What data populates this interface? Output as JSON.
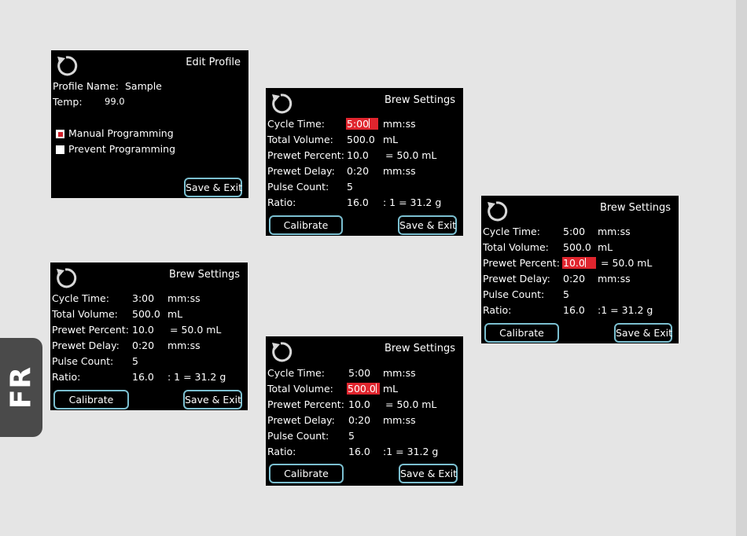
{
  "side_tab": {
    "label": "FR"
  },
  "accent_color": "#e0252e",
  "button_border_color": "#7bbfd0",
  "icons": {
    "refresh": "refresh-icon"
  },
  "edit_profile": {
    "title": "Edit Profile",
    "profile_name_label": "Profile Name:",
    "profile_name_value": "Sample",
    "temp_label": "Temp:",
    "temp_value": "99.0",
    "options": [
      {
        "label": "Manual Programming",
        "checked": true
      },
      {
        "label": "Prevent Programming",
        "checked": false
      }
    ],
    "save_exit": "Save & Exit"
  },
  "brew_screens": [
    {
      "title": "Brew Settings",
      "selected": "cycle_time",
      "rows": [
        {
          "label": "Cycle Time:",
          "value": "5:00",
          "unit": "mm:ss"
        },
        {
          "label": "Total Volume:",
          "value": "500.0",
          "unit": "mL"
        },
        {
          "label": "Prewet Percent:",
          "value": "10.0",
          "unit": "= 50.0 mL"
        },
        {
          "label": "Prewet Delay:",
          "value": "0:20",
          "unit": "mm:ss"
        },
        {
          "label": "Pulse Count:",
          "value": "5",
          "unit": ""
        },
        {
          "label": "Ratio:",
          "value": "16.0",
          "unit": ": 1 = 31.2 g"
        }
      ],
      "calibrate": "Calibrate",
      "save_exit": "Save & Exit"
    },
    {
      "title": "Brew Settings",
      "selected": "prewet_percent",
      "rows": [
        {
          "label": "Cycle Time:",
          "value": "5:00",
          "unit": "mm:ss"
        },
        {
          "label": "Total Volume:",
          "value": "500.0",
          "unit": "mL"
        },
        {
          "label": "Prewet Percent:",
          "value": "10.0",
          "unit": "= 50.0 mL"
        },
        {
          "label": "Prewet Delay:",
          "value": "0:20",
          "unit": "mm:ss"
        },
        {
          "label": "Pulse Count:",
          "value": "5",
          "unit": ""
        },
        {
          "label": "Ratio:",
          "value": "16.0",
          "unit": ":1 = 31.2 g"
        }
      ],
      "calibrate": "Calibrate",
      "save_exit": "Save & Exit"
    },
    {
      "title": "Brew Settings",
      "selected": "none",
      "rows": [
        {
          "label": "Cycle Time:",
          "value": "3:00",
          "unit": "mm:ss"
        },
        {
          "label": "Total Volume:",
          "value": "500.0",
          "unit": "mL"
        },
        {
          "label": "Prewet Percent:",
          "value": "10.0",
          "unit": "= 50.0 mL"
        },
        {
          "label": "Prewet Delay:",
          "value": "0:20",
          "unit": "mm:ss"
        },
        {
          "label": "Pulse Count:",
          "value": "5",
          "unit": ""
        },
        {
          "label": "Ratio:",
          "value": "16.0",
          "unit": ": 1 = 31.2 g"
        }
      ],
      "calibrate": "Calibrate",
      "save_exit": "Save & Exit"
    },
    {
      "title": "Brew Settings",
      "selected": "total_volume",
      "rows": [
        {
          "label": "Cycle Time:",
          "value": "5:00",
          "unit": "mm:ss"
        },
        {
          "label": "Total Volume:",
          "value": "500.0",
          "unit": "mL"
        },
        {
          "label": "Prewet Percent:",
          "value": "10.0",
          "unit": "= 50.0 mL"
        },
        {
          "label": "Prewet Delay:",
          "value": "0:20",
          "unit": "mm:ss"
        },
        {
          "label": "Pulse Count:",
          "value": "5",
          "unit": ""
        },
        {
          "label": "Ratio:",
          "value": "16.0",
          "unit": ":1 = 31.2 g"
        }
      ],
      "calibrate": "Calibrate",
      "save_exit": "Save & Exit"
    }
  ]
}
